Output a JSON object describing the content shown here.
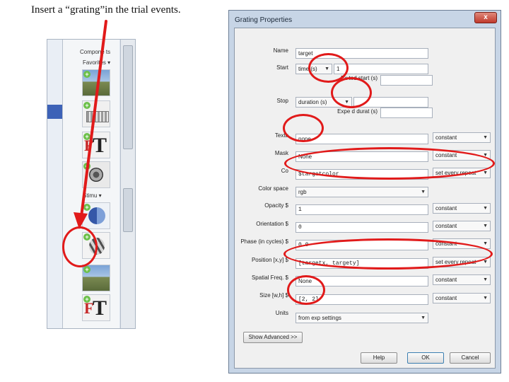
{
  "caption": "Insert a “grating”in the trial events.",
  "components_panel": {
    "header": "Compone ts",
    "favorites_label": "Favorites ▾",
    "stimuli_label": "Stimu ▾",
    "plus_glyph": "+",
    "text_glyph_f": "F",
    "text_glyph_t": "T"
  },
  "dialog": {
    "title": "Grating Properties",
    "close_glyph": "x",
    "fields": {
      "name": {
        "label": "Name",
        "value": "target"
      },
      "start": {
        "label": "Start",
        "type": "time (s)",
        "value": "1",
        "expected_label": "Ex   ted start (s)"
      },
      "stop": {
        "label": "Stop",
        "type": "duration (s)",
        "value": "",
        "expected_label": "Expe   d durat  (s)"
      },
      "texture": {
        "label": "Textu",
        "value": "none",
        "mode": "constant"
      },
      "mask": {
        "label": "Mask",
        "value": "None",
        "mode": "constant"
      },
      "color": {
        "label": "Co",
        "value": "$targetcolor",
        "mode": "set every repeat"
      },
      "color_space": {
        "label": "Color space",
        "value": "rgb"
      },
      "opacity": {
        "label": "Opacity $",
        "value": "1",
        "mode": "constant"
      },
      "orientation": {
        "label": "Orientation $",
        "value": "0",
        "mode": "constant"
      },
      "phase": {
        "label": "Phase (in cycles) $",
        "value": "0.0",
        "mode": "constant"
      },
      "position": {
        "label": "Position [x,y] $",
        "value": "[targetx, targety]",
        "mode": "set every repeat"
      },
      "spatial_freq": {
        "label": "Spatial Freq. $",
        "value": "None",
        "mode": "constant"
      },
      "size": {
        "label": "Size [w,h] $",
        "value": "[2, 2]",
        "mode": "constant"
      },
      "units": {
        "label": "Units",
        "value": "from exp settings"
      }
    },
    "show_advanced": "Show Advanced >>",
    "buttons": {
      "help": "Help",
      "ok": "OK",
      "cancel": "Cancel"
    }
  },
  "annotation_color": "#e11a1a"
}
